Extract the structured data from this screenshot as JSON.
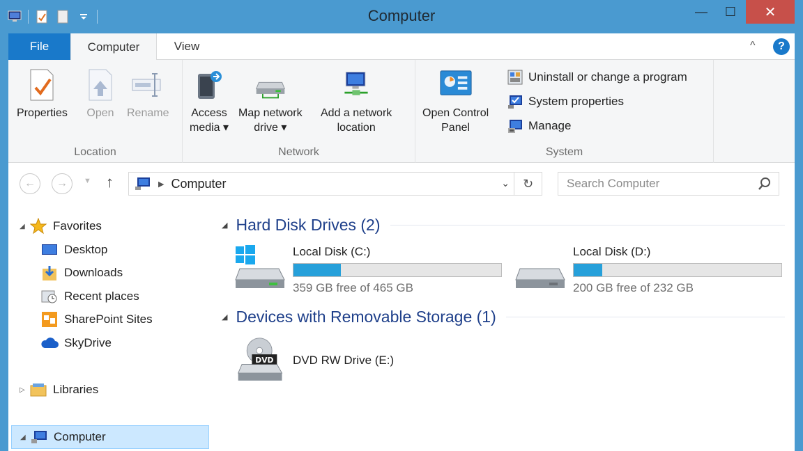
{
  "window": {
    "title": "Computer",
    "minimize": "—",
    "maximize": "☐",
    "close": "✕"
  },
  "ribbon_tabs": {
    "file": "File",
    "computer": "Computer",
    "view": "View"
  },
  "ribbon": {
    "location": {
      "label": "Location",
      "properties": "Properties",
      "open": "Open",
      "rename": "Rename"
    },
    "network": {
      "label": "Network",
      "access_media": [
        "Access",
        "media ▾"
      ],
      "map_network_drive": [
        "Map network",
        "drive ▾"
      ],
      "add_network_location": [
        "Add a network",
        "location"
      ]
    },
    "system": {
      "label": "System",
      "open_control_panel": [
        "Open Control",
        "Panel"
      ],
      "uninstall": "Uninstall or change a program",
      "system_properties": "System properties",
      "manage": "Manage"
    }
  },
  "address_bar": {
    "path": "Computer",
    "search_placeholder": "Search Computer"
  },
  "nav_pane": {
    "favorites": "Favorites",
    "items": [
      "Desktop",
      "Downloads",
      "Recent places",
      "SharePoint Sites",
      "SkyDrive"
    ],
    "libraries": "Libraries",
    "computer": "Computer"
  },
  "main": {
    "hard_disk_header": "Hard Disk Drives (2)",
    "drives": [
      {
        "name": "Local Disk (C:)",
        "free_text": "359 GB free of 465 GB",
        "used_fraction": 0.228
      },
      {
        "name": "Local Disk (D:)",
        "free_text": "200 GB free of 232 GB",
        "used_fraction": 0.138
      }
    ],
    "removable_header": "Devices with Removable Storage (1)",
    "dvd": {
      "name": "DVD RW Drive (E:)",
      "label": "DVD"
    }
  },
  "colors": {
    "accent": "#1979ca",
    "frame": "#4a9ad0",
    "close": "#c7504a",
    "bar_fill": "#26a0da",
    "section_title": "#1e3f8a"
  }
}
